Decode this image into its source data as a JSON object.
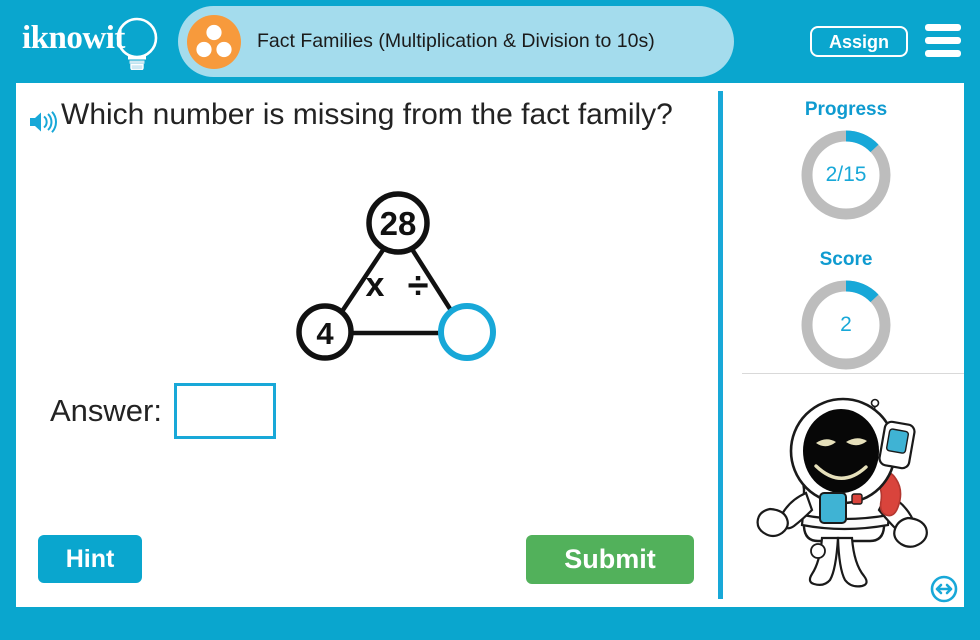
{
  "header": {
    "logo_text": "iknowit",
    "logo_icon": "lightbulb-icon",
    "title": "Fact Families (Multiplication & Division to 10s)",
    "title_icon": "three-dots-circle-icon",
    "assign_label": "Assign",
    "menu_icon": "hamburger-menu-icon",
    "bg_color": "#0aa6ce",
    "pill_color": "#a4dced",
    "title_icon_color": "#f79a3c"
  },
  "question": {
    "audio_icon": "speaker-icon",
    "text": "Which number is missing from the fact family?"
  },
  "diagram": {
    "type": "fact-family-triangle",
    "top_value": "28",
    "bottom_left_value": "4",
    "bottom_right_value": "",
    "bottom_right_empty": true,
    "operators": "x ÷",
    "multiply_symbol": "x",
    "divide_symbol": "÷",
    "filled_stroke_color": "#111111",
    "empty_stroke_color": "#18a8d8"
  },
  "answer": {
    "label": "Answer:",
    "value": "",
    "placeholder": ""
  },
  "actions": {
    "hint_label": "Hint",
    "hint_color": "#0aa6ce",
    "submit_label": "Submit",
    "submit_color": "#52b15b"
  },
  "sidebar": {
    "progress": {
      "title": "Progress",
      "value_text": "2/15",
      "current": 2,
      "total": 15,
      "percent": 13
    },
    "score": {
      "title": "Score",
      "value_text": "2",
      "current": 2,
      "percent": 13
    },
    "mascot": "astronaut-mascot",
    "resize_icon": "resize-horizontal-icon",
    "accent_color": "#18a8d8",
    "track_color": "#bdbdbd"
  }
}
